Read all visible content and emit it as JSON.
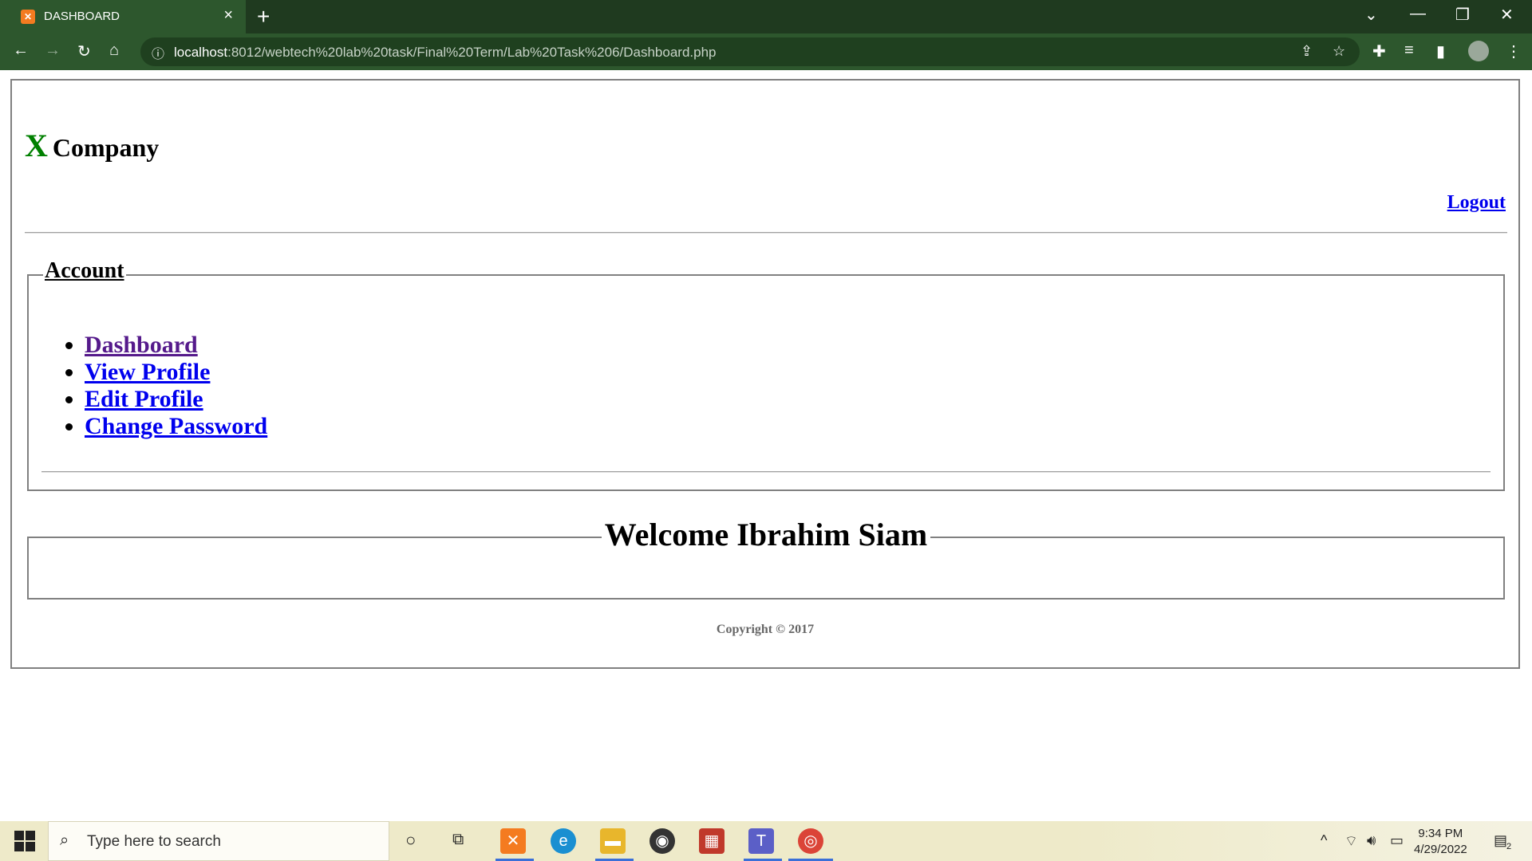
{
  "browser": {
    "tab_title": "DASHBOARD",
    "url_host": "localhost",
    "url_path": ":8012/webtech%20lab%20task/Final%20Term/Lab%20Task%206/Dashboard.php"
  },
  "page": {
    "logo_x": "X",
    "logo_company": "Company",
    "logout": "Logout",
    "account_legend": "Account",
    "menu": [
      {
        "label": "Dashboard"
      },
      {
        "label": "View Profile"
      },
      {
        "label": "Edit Profile"
      },
      {
        "label": "Change Password"
      }
    ],
    "welcome": "Welcome Ibrahim Siam",
    "copyright": "Copyright © 2017"
  },
  "taskbar": {
    "search_placeholder": "Type here to search",
    "time": "9:34 PM",
    "date": "4/29/2022",
    "notifications": "2"
  },
  "colors": {
    "chrome_dark": "#1f3a1f",
    "chrome_tab": "#2d572d",
    "logo_green": "#008000",
    "link_blue": "#0000ee",
    "link_visited": "#551a8b"
  }
}
